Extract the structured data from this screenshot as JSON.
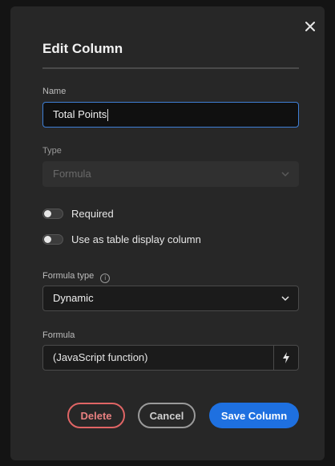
{
  "dialog": {
    "title": "Edit Column"
  },
  "fields": {
    "name": {
      "label": "Name",
      "value": "Total Points"
    },
    "type": {
      "label": "Type",
      "value": "Formula"
    },
    "required": {
      "label": "Required",
      "checked": false
    },
    "display_column": {
      "label": "Use as table display column",
      "checked": false
    },
    "formula_type": {
      "label": "Formula type",
      "value": "Dynamic",
      "info_icon": "info-icon"
    },
    "formula": {
      "label": "Formula",
      "value": "(JavaScript function)",
      "action_icon": "lightning-icon"
    }
  },
  "buttons": {
    "delete": "Delete",
    "cancel": "Cancel",
    "save": "Save Column"
  },
  "colors": {
    "primary": "#1e70e0",
    "danger": "#e06565",
    "focus_border": "#3f7fd6"
  }
}
